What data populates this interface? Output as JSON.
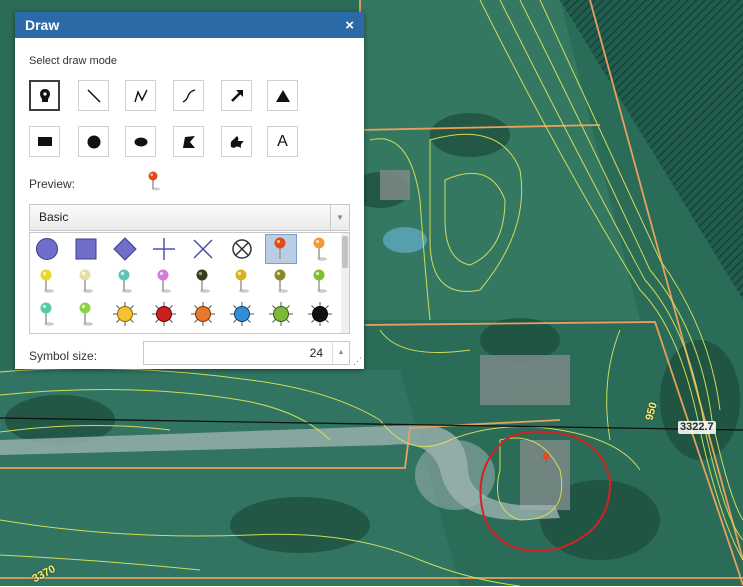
{
  "panel": {
    "title": "Draw",
    "close_label": "×",
    "mode_label": "Select draw mode",
    "modes": [
      {
        "name": "point",
        "icon": "pushpin-icon",
        "selected": true
      },
      {
        "name": "line",
        "icon": "line-icon"
      },
      {
        "name": "polyline",
        "icon": "polyline-icon"
      },
      {
        "name": "freehand-polyline",
        "icon": "freehand-line-icon"
      },
      {
        "name": "arrow",
        "icon": "arrow-icon"
      },
      {
        "name": "triangle",
        "icon": "triangle-icon"
      },
      {
        "name": "rectangle",
        "icon": "rectangle-icon"
      },
      {
        "name": "circle",
        "icon": "circle-icon"
      },
      {
        "name": "ellipse",
        "icon": "ellipse-icon"
      },
      {
        "name": "polygon",
        "icon": "polygon-icon"
      },
      {
        "name": "freehand-polygon",
        "icon": "freehand-polygon-icon"
      },
      {
        "name": "text",
        "icon": "text-icon",
        "text": "A"
      }
    ],
    "preview_label": "Preview:",
    "symbol_set": "Basic",
    "symbol_size_label": "Symbol size:",
    "symbol_size_value": "24",
    "accent_color": "#2b6aa6"
  },
  "map": {
    "labels": [
      {
        "text": "3322.7"
      },
      {
        "text": "950"
      },
      {
        "text": "3370"
      }
    ]
  }
}
